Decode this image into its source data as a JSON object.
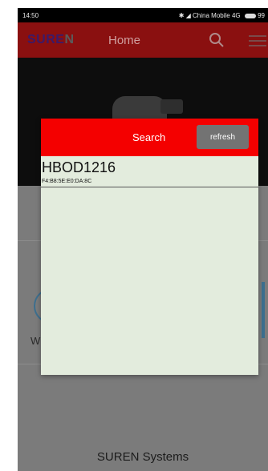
{
  "status_bar": {
    "time": "14:50",
    "carrier": "China Mobile 4G",
    "battery": "99"
  },
  "app_bar": {
    "logo_main": "SURE",
    "logo_tail": "N",
    "title": "Home",
    "icons": [
      "search-icon",
      "menu-icon"
    ]
  },
  "dialog": {
    "title": "Search",
    "refresh_label": "refresh",
    "devices": [
      {
        "name": "HBOD1216",
        "mac": "F4:B8:5E:E0:DA:8C"
      }
    ]
  },
  "background": {
    "partial_text": "W",
    "footer": "SUREN Systems"
  },
  "colors": {
    "app_bar": "#8a1010",
    "dialog_header": "#f40000",
    "dialog_body": "#e3ecdd",
    "refresh_button": "#737373",
    "dim_overlay": "#7b7b7b"
  }
}
